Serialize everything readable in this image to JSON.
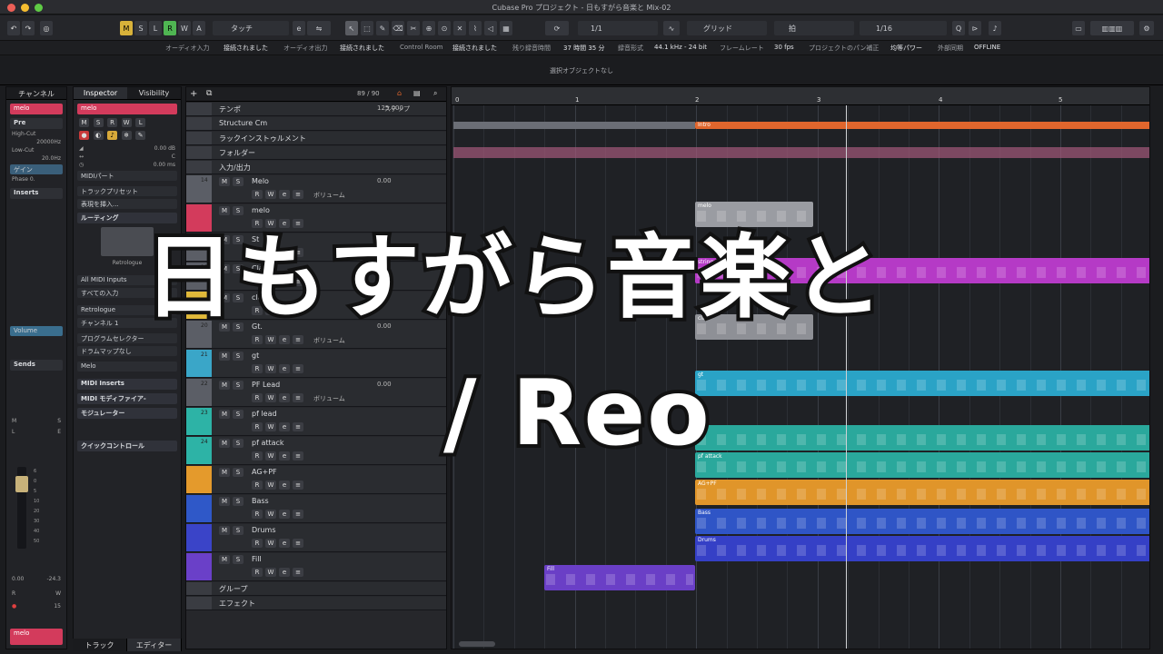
{
  "window": {
    "title": "Cubase Pro プロジェクト - 日もすがら音楽と Mix-02"
  },
  "toolbar": {
    "msrwa": [
      "M",
      "S",
      "L",
      "R",
      "W",
      "A"
    ],
    "automation_mode": "タッチ",
    "quantize_ratio": "1/1",
    "snap_mode": "グリッド",
    "grid_type": "拍",
    "quantize": "1/16",
    "tempo_button_label": "e"
  },
  "status": {
    "items": [
      {
        "label": "オーディオ入力",
        "value": "接続されました"
      },
      {
        "label": "オーディオ出力",
        "value": "接続されました"
      },
      {
        "label": "Control Room",
        "value": "接続されました"
      },
      {
        "label": "残り録音時間",
        "value": "37 時間 35 分"
      },
      {
        "label": "録音形式",
        "value": "44.1 kHz - 24 bit"
      },
      {
        "label": "フレームレート",
        "value": "30 fps"
      },
      {
        "label": "プロジェクトのパン補正",
        "value": "均等パワー"
      },
      {
        "label": "外部同期",
        "value": "OFFLINE"
      }
    ]
  },
  "infoline": "選択オブジェクトなし",
  "channel": {
    "tab": "チャンネル",
    "name": "melo",
    "pre": "Pre",
    "highcut": "High-Cut",
    "highcut_val": "20000Hz",
    "lowcut": "Low-Cut",
    "lowcut_val": "20.0Hz",
    "gain": "ゲイン",
    "phase": "Phase 0.",
    "inserts": "Inserts",
    "volume": "Volume",
    "sends": "Sends",
    "vol_readout": "0.00",
    "peak_readout": "-24.3",
    "bottom_num": "15",
    "footer_name": "melo",
    "rw": [
      "R",
      "W"
    ],
    "ms": [
      "M",
      "S"
    ],
    "lr": [
      "L",
      "E"
    ],
    "meter_scale": [
      "6",
      "0",
      "5",
      "10",
      "20",
      "30",
      "40",
      "50"
    ]
  },
  "inspector": {
    "tabs": [
      "Inspector",
      "Visibility"
    ],
    "track_name": "melo",
    "buttons": [
      "M",
      "S",
      "R",
      "W",
      "L"
    ],
    "vol": "0.00 dB",
    "pan": "C",
    "delay": "0.00 ms",
    "midi_part": "MIDIパート",
    "track_preset": "トラックプリセット",
    "expression": "表現を挿入...",
    "routing": "ルーティング",
    "instrument": "Retrologue",
    "midi_in": "All MIDI Inputs",
    "midi_in2": "すべての入力",
    "out": "Retrologue",
    "midi_ch": "チャンネル 1",
    "program": "プログラムセレクター",
    "drummap": "ドラムマップなし",
    "melo_sel": "Melo",
    "midi_inserts": "MIDI Inserts",
    "midi_modifier": "MIDI モディファイア-",
    "modulator": "モジュレーター",
    "quick_controls": "クイックコントロール",
    "bottom_tabs": [
      "トラック",
      "エディター"
    ]
  },
  "tracklist": {
    "counter": "89 / 90",
    "tracks": [
      {
        "name": "テンポ",
        "value": "125.000",
        "extra": "ステップ",
        "num": "",
        "color": "#3a3c42"
      },
      {
        "name": "Structure Cm",
        "value": "",
        "extra": "",
        "num": "",
        "color": "#3a3c42"
      },
      {
        "name": "ラックインストゥルメント",
        "value": "",
        "extra": "",
        "num": "",
        "color": "#3a3c42"
      },
      {
        "name": "フォルダー",
        "value": "",
        "extra": "",
        "num": "",
        "color": "#3a3c42"
      },
      {
        "name": "入力/出力",
        "value": "",
        "extra": "",
        "num": "",
        "color": "#3a3c42"
      },
      {
        "name": "Melo",
        "value": "0.00",
        "extra": "ボリューム",
        "num": "14",
        "color": "#5b5e66"
      },
      {
        "name": "melo",
        "value": "",
        "extra": "",
        "num": "",
        "color": "#d33b5c"
      },
      {
        "name": "St",
        "value": "",
        "extra": "",
        "num": "16",
        "color": "#5b5e66"
      },
      {
        "name": "Clav",
        "value": "",
        "extra": "",
        "num": "18",
        "color": "#5b5e66"
      },
      {
        "name": "clav",
        "value": "",
        "extra": "",
        "num": "",
        "color": "#e1b93a"
      },
      {
        "name": "Gt.",
        "value": "0.00",
        "extra": "ボリューム",
        "num": "20",
        "color": "#5b5e66"
      },
      {
        "name": "gt",
        "value": "",
        "extra": "",
        "num": "21",
        "color": "#3aa6c8"
      },
      {
        "name": "PF Lead",
        "value": "0.00",
        "extra": "ボリューム",
        "num": "22",
        "color": "#5b5e66"
      },
      {
        "name": "pf lead",
        "value": "",
        "extra": "",
        "num": "23",
        "color": "#2db3a6"
      },
      {
        "name": "pf attack",
        "value": "",
        "extra": "",
        "num": "24",
        "color": "#2db3a6"
      },
      {
        "name": "AG+PF",
        "value": "",
        "extra": "",
        "num": "",
        "color": "#e49a2c"
      },
      {
        "name": "Bass",
        "value": "",
        "extra": "",
        "num": "",
        "color": "#2f58c8"
      },
      {
        "name": "Drums",
        "value": "",
        "extra": "",
        "num": "",
        "color": "#3a44c8"
      },
      {
        "name": "Fill",
        "value": "",
        "extra": "",
        "num": "",
        "color": "#6a40c8"
      },
      {
        "name": "グループ",
        "value": "",
        "extra": "",
        "num": "",
        "color": "#3a3c42"
      },
      {
        "name": "エフェクト",
        "value": "",
        "extra": "",
        "num": "",
        "color": "#3a3c42"
      }
    ]
  },
  "ruler": {
    "bars": [
      "0",
      "1",
      "2",
      "3",
      "4",
      "5"
    ]
  },
  "clips": [
    {
      "label": "Intro",
      "color": "#e0662d"
    },
    {
      "label": "melo",
      "color": "#9a9ca2"
    },
    {
      "label": "strings",
      "color": "#b53ac6"
    },
    {
      "label": "clav",
      "color": "#8e9096"
    },
    {
      "label": "gt",
      "color": "#2aa3c6"
    },
    {
      "label": "",
      "color": "#2aa89c"
    },
    {
      "label": "pf attack",
      "color": "#2aa89c"
    },
    {
      "label": "AG+PF",
      "color": "#e0952a"
    },
    {
      "label": "Bass",
      "color": "#2f55c6"
    },
    {
      "label": "Drums",
      "color": "#3540c6"
    },
    {
      "label": "Fill",
      "color": "#6a3fc6"
    }
  ],
  "overlay": {
    "line1": "日もすがら音楽と",
    "line2": "/ Reo"
  }
}
